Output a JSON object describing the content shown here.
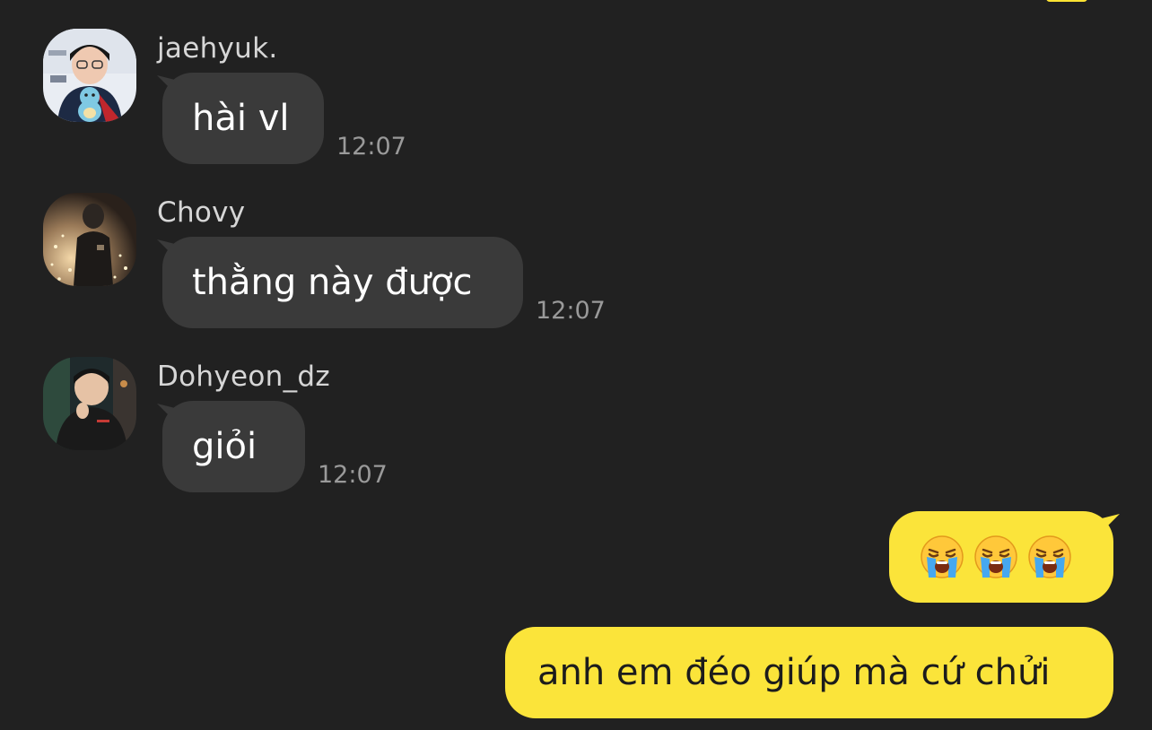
{
  "chat": {
    "accent_outgoing": "#fbe43a",
    "incoming_bubble_color": "#3a3a3a",
    "background": "#212121",
    "messages": [
      {
        "sender": "jaehyuk.",
        "avatar": "avatar-photo",
        "text": "hài vl",
        "time": "12:07"
      },
      {
        "sender": "Chovy",
        "avatar": "avatar-photo",
        "text": "thằng này được",
        "time": "12:07"
      },
      {
        "sender": "Dohyeon_dz",
        "avatar": "avatar-photo",
        "text": "giỏi",
        "time": "12:07"
      }
    ],
    "outgoing": [
      {
        "emoji": [
          "😭",
          "😭",
          "😭"
        ],
        "emoji_name": "loudly-crying-face-icon"
      },
      {
        "text": "anh em đéo giúp mà cứ chửi"
      }
    ]
  }
}
